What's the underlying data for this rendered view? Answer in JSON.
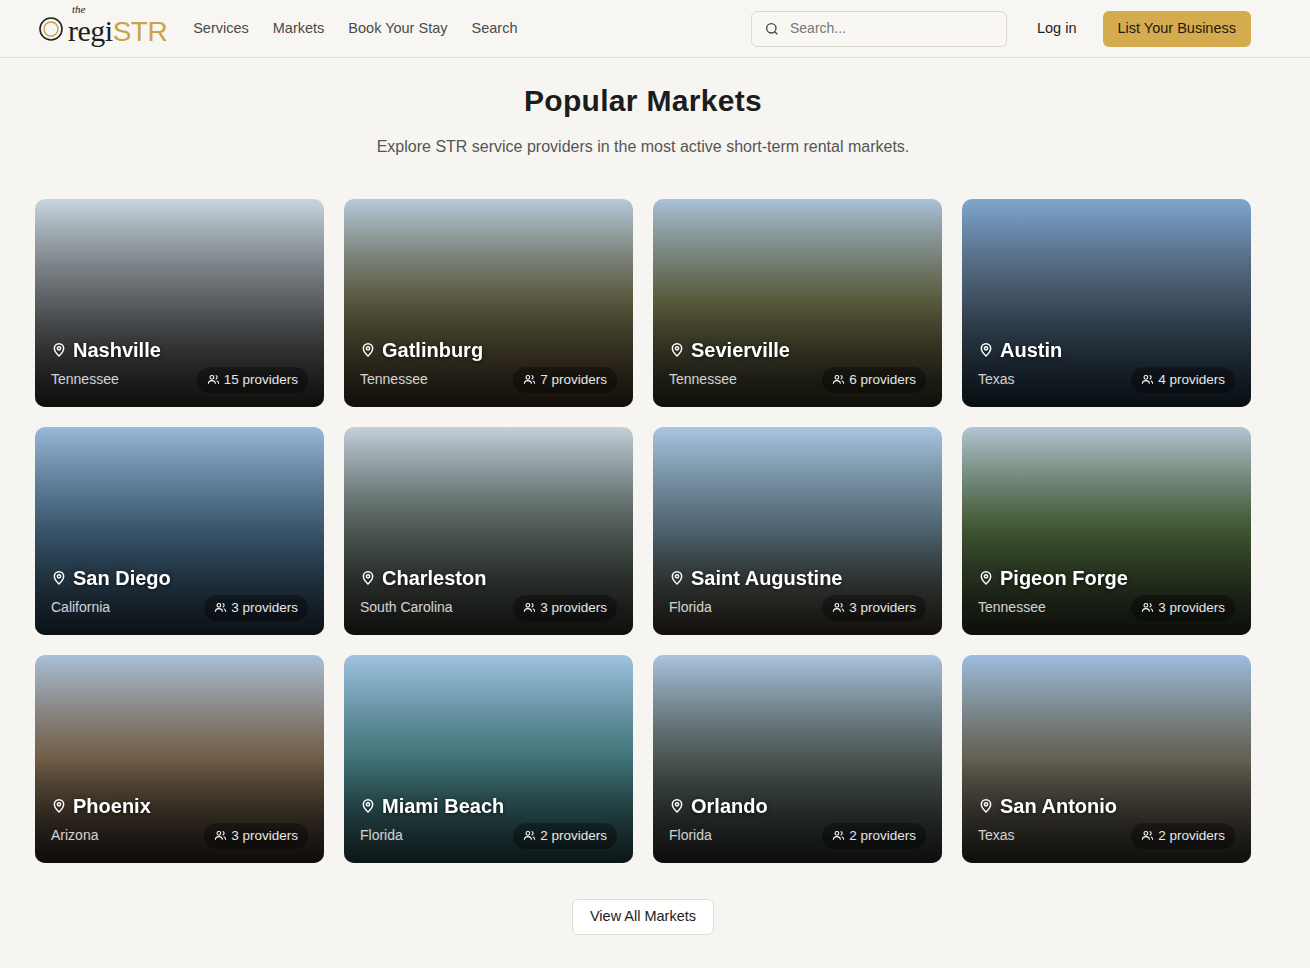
{
  "logo": {
    "prefix": "the",
    "main": "regi",
    "accent": "STR"
  },
  "nav": [
    "Services",
    "Markets",
    "Book Your Stay",
    "Search"
  ],
  "search": {
    "placeholder": "Search..."
  },
  "login": "Log in",
  "cta": "List Your Business",
  "heading": "Popular Markets",
  "subtitle": "Explore STR service providers in the most active short-term rental markets.",
  "markets": [
    {
      "name": "Nashville",
      "state": "Tennessee",
      "providers": "15 providers"
    },
    {
      "name": "Gatlinburg",
      "state": "Tennessee",
      "providers": "7 providers"
    },
    {
      "name": "Sevierville",
      "state": "Tennessee",
      "providers": "6 providers"
    },
    {
      "name": "Austin",
      "state": "Texas",
      "providers": "4 providers"
    },
    {
      "name": "San Diego",
      "state": "California",
      "providers": "3 providers"
    },
    {
      "name": "Charleston",
      "state": "South Carolina",
      "providers": "3 providers"
    },
    {
      "name": "Saint Augustine",
      "state": "Florida",
      "providers": "3 providers"
    },
    {
      "name": "Pigeon Forge",
      "state": "Tennessee",
      "providers": "3 providers"
    },
    {
      "name": "Phoenix",
      "state": "Arizona",
      "providers": "3 providers"
    },
    {
      "name": "Miami Beach",
      "state": "Florida",
      "providers": "2 providers"
    },
    {
      "name": "Orlando",
      "state": "Florida",
      "providers": "2 providers"
    },
    {
      "name": "San Antonio",
      "state": "Texas",
      "providers": "2 providers"
    }
  ],
  "view_all": "View All Markets"
}
